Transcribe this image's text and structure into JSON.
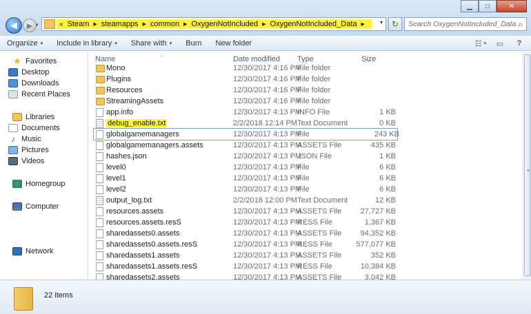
{
  "window": {
    "controls": {
      "minimize": "▁",
      "maximize": "□",
      "close": "✕"
    }
  },
  "nav": {
    "back": "◀",
    "forward": "▶",
    "dropdown": "▾"
  },
  "address": {
    "overflow": "«",
    "crumbs": [
      "Steam",
      "steamapps",
      "common",
      "OxygenNotIncluded",
      "OxygenNotIncluded_Data"
    ],
    "separator": "▶",
    "dropdown": "▾",
    "highlight_color": "#fff23f"
  },
  "refresh": {
    "icon": "↻"
  },
  "search": {
    "placeholder": "Search OxygenNotIncluded_Data",
    "icon": "⌕"
  },
  "toolbar": {
    "organize": "Organize",
    "include_in_library": "Include in library",
    "share_with": "Share with",
    "burn": "Burn",
    "new_folder": "New folder",
    "dropdown_arrow": "▾",
    "views_icon": "☷",
    "preview_icon": "▭",
    "help_icon": "?"
  },
  "sidebar": {
    "favorites": {
      "label": "Favorites",
      "items": [
        "Desktop",
        "Downloads",
        "Recent Places"
      ]
    },
    "libraries": {
      "label": "Libraries",
      "items": [
        "Documents",
        "Music",
        "Pictures",
        "Videos"
      ]
    },
    "homegroup": "Homegroup",
    "computer": "Computer",
    "network": "Network"
  },
  "columns": {
    "name": "Name",
    "date": "Date modified",
    "type": "Type",
    "size": "Size",
    "sort_arrow": "^"
  },
  "files": [
    {
      "name": "Mono",
      "date": "12/30/2017 4:16 PM",
      "type": "File folder",
      "size": "",
      "kind": "folder"
    },
    {
      "name": "Plugins",
      "date": "12/30/2017 4:16 PM",
      "type": "File folder",
      "size": "",
      "kind": "folder"
    },
    {
      "name": "Resources",
      "date": "12/30/2017 4:16 PM",
      "type": "File folder",
      "size": "",
      "kind": "folder"
    },
    {
      "name": "StreamingAssets",
      "date": "12/30/2017 4:16 PM",
      "type": "File folder",
      "size": "",
      "kind": "folder"
    },
    {
      "name": "app.info",
      "date": "12/30/2017 4:13 PM",
      "type": "INFO File",
      "size": "1 KB",
      "kind": "file"
    },
    {
      "name": "debug_enable.txt",
      "date": "2/2/2018 12:14 PM",
      "type": "Text Document",
      "size": "0 KB",
      "kind": "txt",
      "highlighted": true
    },
    {
      "name": "globalgamemanagers",
      "date": "12/30/2017 4:13 PM",
      "type": "File",
      "size": "243 KB",
      "kind": "file",
      "selected": true
    },
    {
      "name": "globalgamemanagers.assets",
      "date": "12/30/2017 4:13 PM",
      "type": "ASSETS File",
      "size": "435 KB",
      "kind": "file"
    },
    {
      "name": "hashes.json",
      "date": "12/30/2017 4:13 PM",
      "type": "JSON File",
      "size": "1 KB",
      "kind": "file"
    },
    {
      "name": "level0",
      "date": "12/30/2017 4:13 PM",
      "type": "File",
      "size": "6 KB",
      "kind": "file"
    },
    {
      "name": "level1",
      "date": "12/30/2017 4:13 PM",
      "type": "File",
      "size": "6 KB",
      "kind": "file"
    },
    {
      "name": "level2",
      "date": "12/30/2017 4:13 PM",
      "type": "File",
      "size": "6 KB",
      "kind": "file"
    },
    {
      "name": "output_log.txt",
      "date": "2/2/2018 12:00 PM",
      "type": "Text Document",
      "size": "12 KB",
      "kind": "txt"
    },
    {
      "name": "resources.assets",
      "date": "12/30/2017 4:13 PM",
      "type": "ASSETS File",
      "size": "27,727 KB",
      "kind": "file"
    },
    {
      "name": "resources.assets.resS",
      "date": "12/30/2017 4:13 PM",
      "type": "RESS File",
      "size": "1,367 KB",
      "kind": "file"
    },
    {
      "name": "sharedassets0.assets",
      "date": "12/30/2017 4:13 PM",
      "type": "ASSETS File",
      "size": "94,352 KB",
      "kind": "file"
    },
    {
      "name": "sharedassets0.assets.resS",
      "date": "12/30/2017 4:13 PM",
      "type": "RESS File",
      "size": "577,077 KB",
      "kind": "file"
    },
    {
      "name": "sharedassets1.assets",
      "date": "12/30/2017 4:13 PM",
      "type": "ASSETS File",
      "size": "352 KB",
      "kind": "file"
    },
    {
      "name": "sharedassets1.assets.resS",
      "date": "12/30/2017 4:13 PM",
      "type": "RESS File",
      "size": "10,384 KB",
      "kind": "file"
    },
    {
      "name": "sharedassets2.assets",
      "date": "12/30/2017 4:13 PM",
      "type": "ASSETS File",
      "size": "3,042 KB",
      "kind": "file"
    }
  ],
  "scrollbar": {
    "grip": "≡"
  },
  "status": {
    "item_count": "22 items"
  }
}
